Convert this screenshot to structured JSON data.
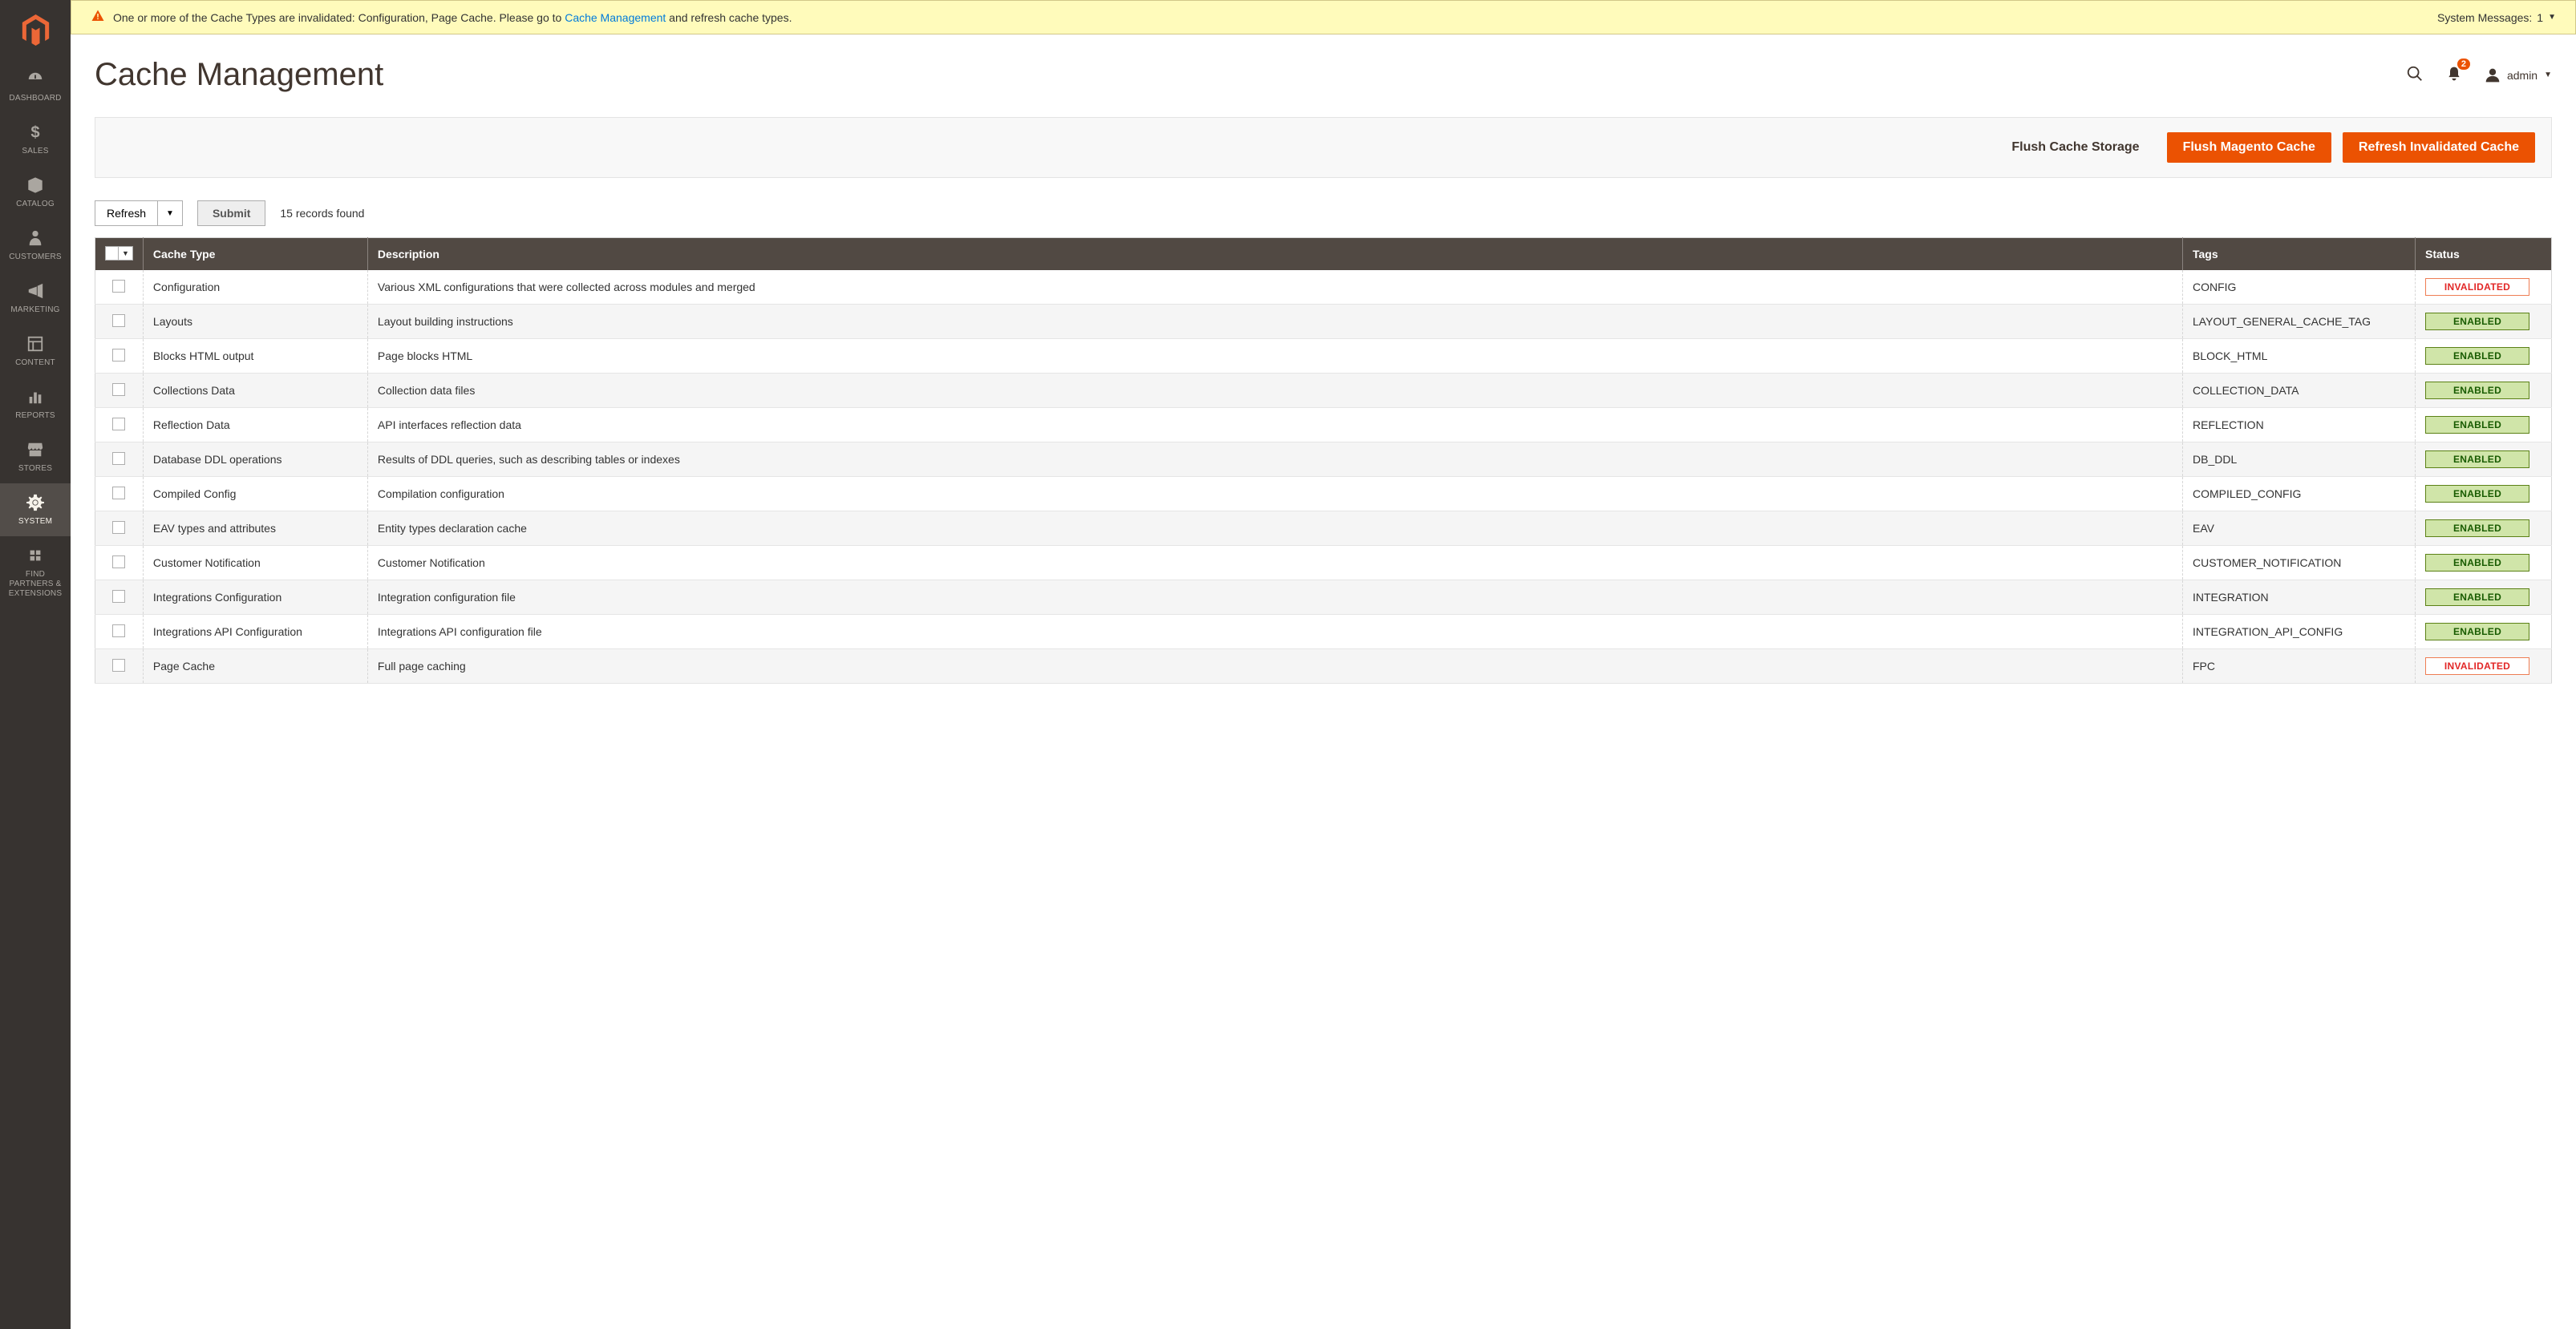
{
  "sidebar": {
    "items": [
      {
        "label": "DASHBOARD",
        "icon": "dashboard"
      },
      {
        "label": "SALES",
        "icon": "dollar"
      },
      {
        "label": "CATALOG",
        "icon": "catalog"
      },
      {
        "label": "CUSTOMERS",
        "icon": "customers"
      },
      {
        "label": "MARKETING",
        "icon": "marketing"
      },
      {
        "label": "CONTENT",
        "icon": "content"
      },
      {
        "label": "REPORTS",
        "icon": "reports"
      },
      {
        "label": "STORES",
        "icon": "stores"
      },
      {
        "label": "SYSTEM",
        "icon": "system",
        "active": true
      },
      {
        "label": "FIND PARTNERS & EXTENSIONS",
        "icon": "partners"
      }
    ]
  },
  "sysmsg": {
    "text_before": "One or more of the Cache Types are invalidated: Configuration, Page Cache. Please go to ",
    "link": "Cache Management",
    "text_after": " and refresh cache types.",
    "right_label": "System Messages:",
    "right_count": "1"
  },
  "page": {
    "title": "Cache Management"
  },
  "header": {
    "notif_badge": "2",
    "user": "admin"
  },
  "actions": {
    "flush_storage": "Flush Cache Storage",
    "flush_magento": "Flush Magento Cache",
    "refresh_invalidated": "Refresh Invalidated Cache"
  },
  "toolbar": {
    "mass_action": "Refresh",
    "submit": "Submit",
    "records": "15 records found"
  },
  "table": {
    "headers": {
      "cache_type": "Cache Type",
      "description": "Description",
      "tags": "Tags",
      "status": "Status"
    },
    "rows": [
      {
        "type": "Configuration",
        "desc": "Various XML configurations that were collected across modules and merged",
        "tags": "CONFIG",
        "status": "INVALIDATED"
      },
      {
        "type": "Layouts",
        "desc": "Layout building instructions",
        "tags": "LAYOUT_GENERAL_CACHE_TAG",
        "status": "ENABLED"
      },
      {
        "type": "Blocks HTML output",
        "desc": "Page blocks HTML",
        "tags": "BLOCK_HTML",
        "status": "ENABLED"
      },
      {
        "type": "Collections Data",
        "desc": "Collection data files",
        "tags": "COLLECTION_DATA",
        "status": "ENABLED"
      },
      {
        "type": "Reflection Data",
        "desc": "API interfaces reflection data",
        "tags": "REFLECTION",
        "status": "ENABLED"
      },
      {
        "type": "Database DDL operations",
        "desc": "Results of DDL queries, such as describing tables or indexes",
        "tags": "DB_DDL",
        "status": "ENABLED"
      },
      {
        "type": "Compiled Config",
        "desc": "Compilation configuration",
        "tags": "COMPILED_CONFIG",
        "status": "ENABLED"
      },
      {
        "type": "EAV types and attributes",
        "desc": "Entity types declaration cache",
        "tags": "EAV",
        "status": "ENABLED"
      },
      {
        "type": "Customer Notification",
        "desc": "Customer Notification",
        "tags": "CUSTOMER_NOTIFICATION",
        "status": "ENABLED"
      },
      {
        "type": "Integrations Configuration",
        "desc": "Integration configuration file",
        "tags": "INTEGRATION",
        "status": "ENABLED"
      },
      {
        "type": "Integrations API Configuration",
        "desc": "Integrations API configuration file",
        "tags": "INTEGRATION_API_CONFIG",
        "status": "ENABLED"
      },
      {
        "type": "Page Cache",
        "desc": "Full page caching",
        "tags": "FPC",
        "status": "INVALIDATED"
      }
    ]
  }
}
